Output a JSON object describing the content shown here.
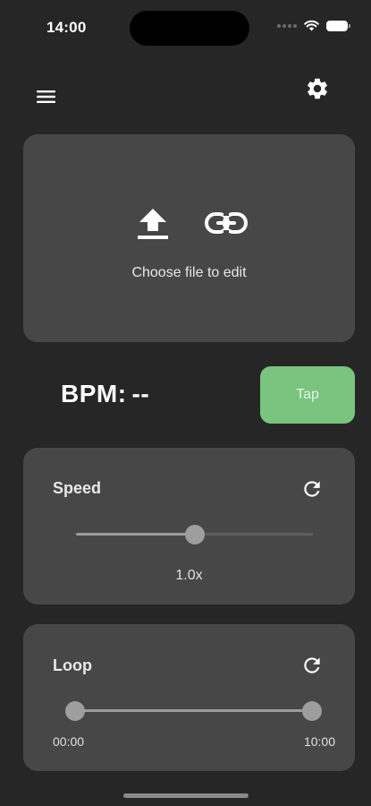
{
  "status_bar": {
    "time": "14:00",
    "icons": [
      "signal-dots-icon",
      "wifi-icon",
      "battery-icon"
    ]
  },
  "toolbar": {
    "menu_icon": "hamburger-menu-icon",
    "settings_icon": "gear-icon"
  },
  "upload": {
    "upload_icon": "upload-icon",
    "link_icon": "link-icon",
    "label": "Choose file to edit"
  },
  "bpm": {
    "label": "BPM:",
    "value": "--",
    "tap_label": "Tap",
    "tap_color": "#79c47e"
  },
  "speed": {
    "title": "Speed",
    "reset_icon": "refresh-icon",
    "value_label": "1.0x",
    "slider_fraction": 0.5
  },
  "loop": {
    "title": "Loop",
    "reset_icon": "refresh-icon",
    "start_label": "00:00",
    "end_label": "10:00",
    "range_start_fraction": 0.0,
    "range_end_fraction": 1.0
  },
  "colors": {
    "background": "#262626",
    "card": "#474747",
    "accent": "#79c47e"
  }
}
